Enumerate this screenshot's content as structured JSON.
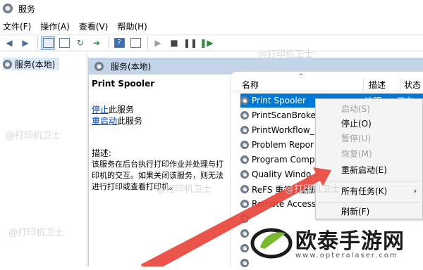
{
  "window": {
    "title": "服务"
  },
  "menu": [
    "文件(F)",
    "操作(A)",
    "查看(V)",
    "帮助(H)"
  ],
  "tree": {
    "node_label": "服务(本地)"
  },
  "pane_header": "服务(本地)",
  "detail": {
    "service_name": "Print Spooler",
    "stop_link": "停止",
    "stop_suffix": "此服务",
    "restart_link": "重启动",
    "restart_suffix": "此服务",
    "desc_label": "描述:",
    "description": "该服务在后台执行打印作业并处理与打印机的交互。如果关闭该服务，则无法进行打印或查看打印机。"
  },
  "columns": [
    "名称",
    "描述",
    "状态"
  ],
  "services": [
    "Print Spooler",
    "PrintScanBroke",
    "PrintWorkflow_",
    "Problem Repor",
    "Program Comp",
    "Quality Windo",
    "ReFS 重复数据删除",
    "Remote Access",
    "",
    "",
    "",
    ""
  ],
  "status_fragments": {
    "desc_selected": "该服",
    "status_selected": "正在"
  },
  "context_menu": {
    "start": "启动(S)",
    "stop": "停止(O)",
    "pause": "暂停(U)",
    "resume": "恢复(M)",
    "restart": "重新启动(E)",
    "all_tasks": "所有任务(K)",
    "refresh": "刷新(F)"
  },
  "watermark": "@打印机卫士",
  "logo": {
    "name": "欧泰手游网",
    "url": "www.opteralaser.com"
  },
  "colors": {
    "selection": "#0078d7",
    "header": "#c3d4e8",
    "arrow": "#e8453c",
    "logo_green": "#7ab832"
  }
}
